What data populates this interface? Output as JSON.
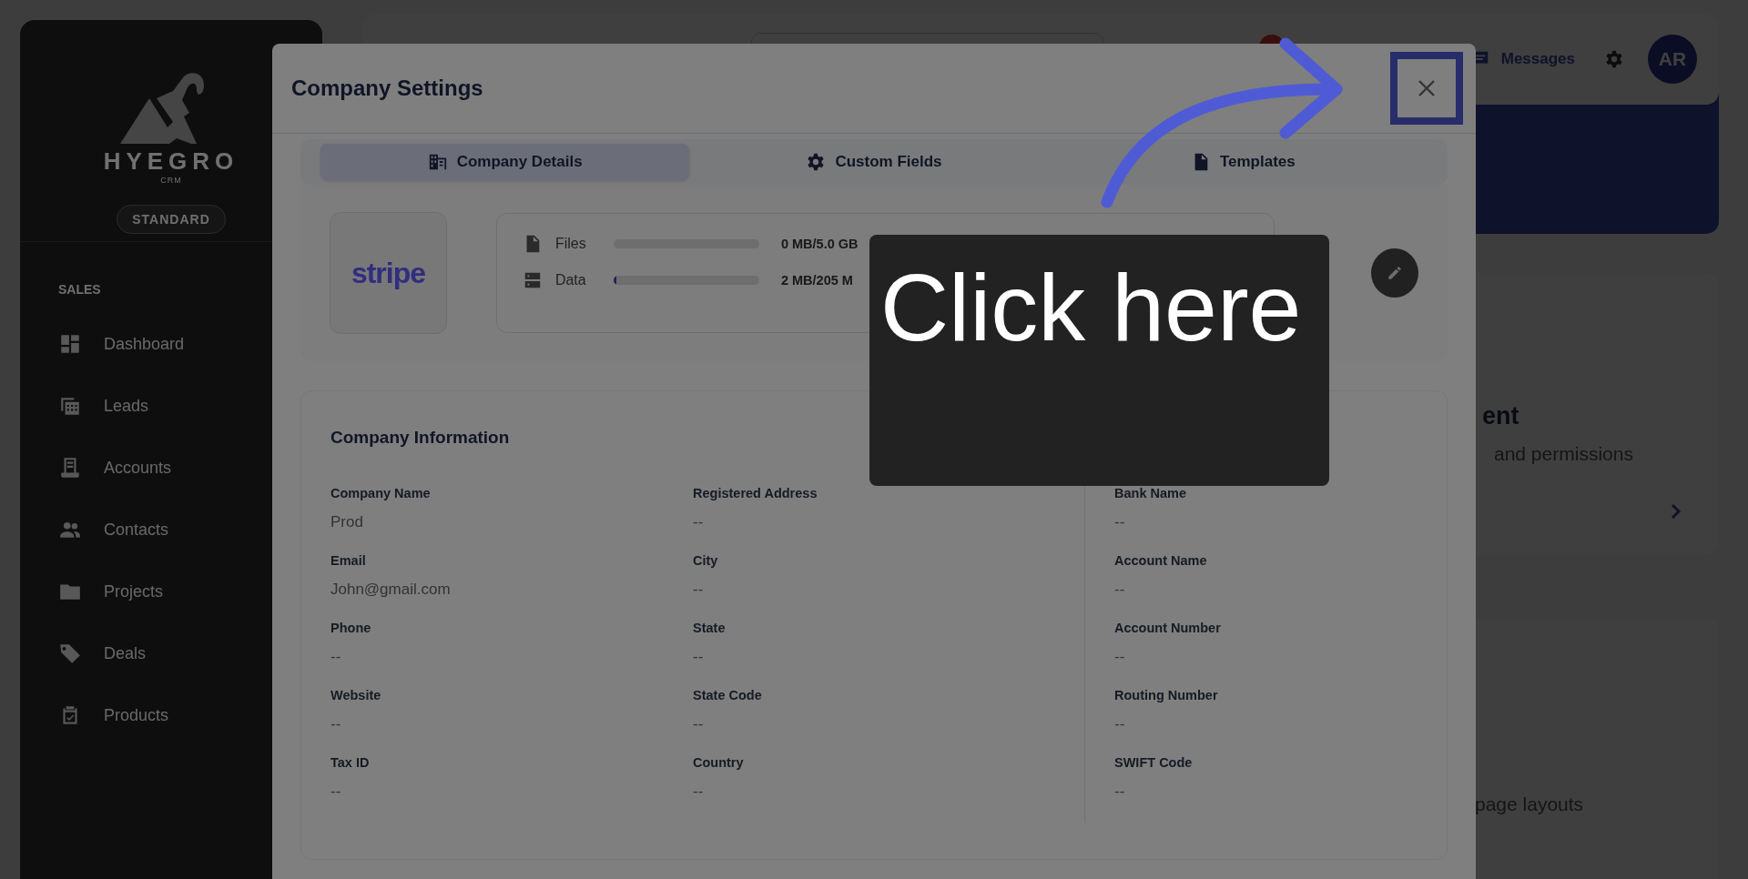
{
  "sidebar": {
    "brand": "HYEGRO",
    "brand_sub": "CRM",
    "plan": "STANDARD",
    "section": "SALES",
    "items": [
      {
        "label": "Dashboard"
      },
      {
        "label": "Leads"
      },
      {
        "label": "Accounts"
      },
      {
        "label": "Contacts"
      },
      {
        "label": "Projects"
      },
      {
        "label": "Deals"
      },
      {
        "label": "Products"
      }
    ]
  },
  "header": {
    "messages": "Messages",
    "avatar": "AR"
  },
  "background_cards": [
    {
      "title": "ent",
      "subtitle": "and permissions"
    },
    {
      "subtitle": "page layouts"
    }
  ],
  "modal": {
    "title": "Company Settings",
    "tabs": [
      {
        "label": "Company Details",
        "selected": true
      },
      {
        "label": "Custom Fields",
        "selected": false
      },
      {
        "label": "Templates",
        "selected": false
      }
    ],
    "logo": "stripe",
    "storage": [
      {
        "label": "Files",
        "reading": "0 MB/5.0 GB"
      },
      {
        "label": "Data",
        "level": 0.01,
        "reading": "2 MB/205 M"
      }
    ],
    "columns": [
      {
        "title": "Company Information",
        "fields": [
          {
            "label": "Company Name",
            "value": "Prod"
          },
          {
            "label": "Email",
            "value": "John@gmail.com"
          },
          {
            "label": "Phone",
            "value": "--"
          },
          {
            "label": "Website",
            "value": "--"
          },
          {
            "label": "Tax ID",
            "value": "--"
          }
        ]
      },
      {
        "fields": [
          {
            "label": "Registered Address",
            "value": "--"
          },
          {
            "label": "City",
            "value": "--"
          },
          {
            "label": "State",
            "value": "--"
          },
          {
            "label": "State Code",
            "value": "--"
          },
          {
            "label": "Country",
            "value": "--"
          }
        ]
      },
      {
        "fields": [
          {
            "label": "Bank Name",
            "value": "--"
          },
          {
            "label": "Account Name",
            "value": "--"
          },
          {
            "label": "Account Number",
            "value": "--"
          },
          {
            "label": "Routing Number",
            "value": "--"
          },
          {
            "label": "SWIFT Code",
            "value": "--"
          }
        ]
      }
    ]
  },
  "callout": {
    "text": "Click here"
  }
}
